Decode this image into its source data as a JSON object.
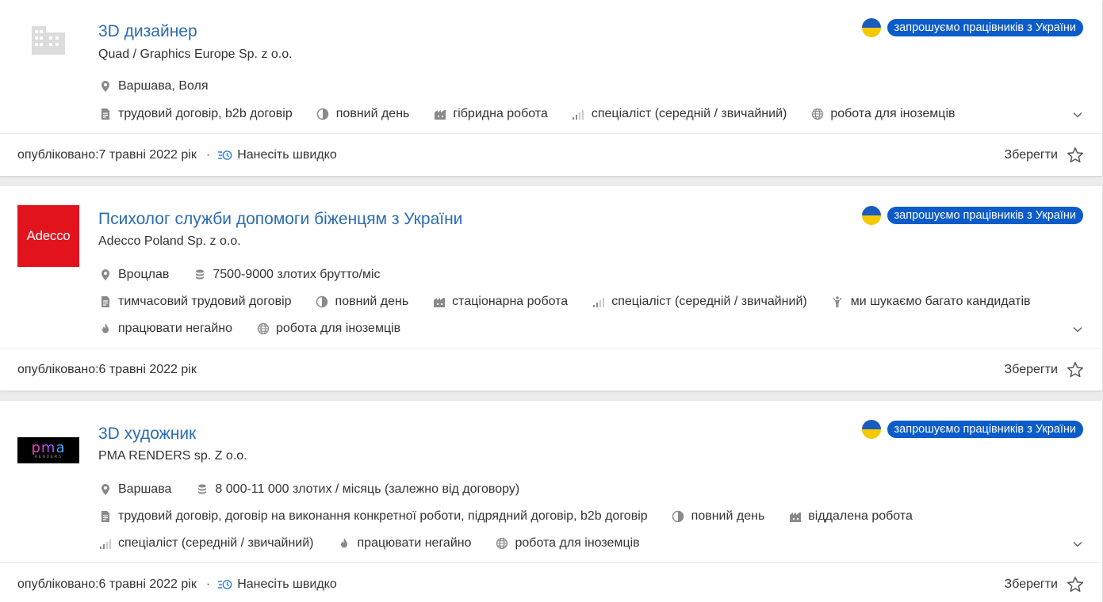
{
  "colors": {
    "title": "#2a6bb3",
    "badge_bg": "#0b5cc9",
    "flag_blue": "#1a5bbf",
    "flag_yellow": "#f5c800",
    "adecco_red": "#e2131d",
    "page_bg": "#ececec"
  },
  "jobs": [
    {
      "title": "3D дизайнер",
      "company": "Quad / Graphics Europe Sp. z o.o.",
      "logo_icon": "building-icon",
      "badge": "запрошуємо працівників з України",
      "location": "Варшава, Воля",
      "contract": "трудовий договір, b2b договір",
      "schedule": "повний день",
      "work_mode": "гібридна робота",
      "level": "спеціаліст (середній / звичайний)",
      "foreigners": "робота для іноземців",
      "published": "опубліковано:7 травні 2022 рік",
      "quick_apply": "Нанесіть швидко",
      "save": "Зберегти"
    },
    {
      "title": "Психолог служби допомоги біженцям з України",
      "company": "Adecco Poland Sp. z o.o.",
      "logo_text": "Adecco",
      "badge": "запрошуємо працівників з України",
      "location": "Вроцлав",
      "salary": "7500-9000 злотих брутто/міс",
      "contract": "тимчасовий трудовий договір",
      "schedule": "повний день",
      "work_mode": "стаціонарна робота",
      "level": "спеціаліст (середній / звичайний)",
      "many_candidates": "ми шукаємо багато кандидатів",
      "immediate": "працювати негайно",
      "foreigners": "робота для іноземців",
      "published": "опубліковано:6 травні 2022 рік",
      "save": "Зберегти"
    },
    {
      "title": "3D художник",
      "company": "PMA RENDERS sp. Z o.o.",
      "logo_text": "pma",
      "logo_sub": "RENDERS",
      "badge": "запрошуємо працівників з України",
      "location": "Варшава",
      "salary": "8 000-11 000 злотих / місяць (залежно від договору)",
      "contract": "трудовий договір, договір на виконання конкретної роботи, підрядний договір, b2b договір",
      "schedule": "повний день",
      "work_mode": "віддалена робота",
      "level": "спеціаліст (середній / звичайний)",
      "immediate": "працювати негайно",
      "foreigners": "робота для іноземців",
      "published": "опубліковано:6 травні 2022 рік",
      "quick_apply": "Нанесіть швидко",
      "save": "Зберегти"
    }
  ]
}
